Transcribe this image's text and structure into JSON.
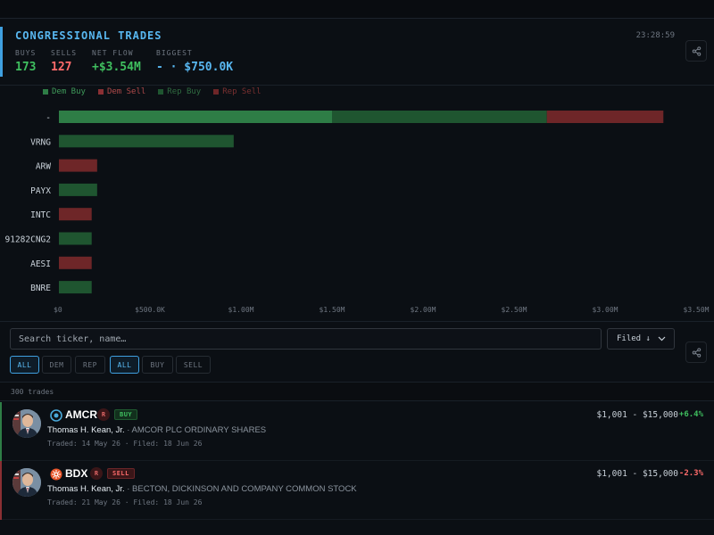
{
  "header": {
    "title": "CONGRESSIONAL TRADES",
    "time": "23:28:59",
    "stats": [
      {
        "label": "BUYS",
        "value": "173",
        "color": "#3fbf5f"
      },
      {
        "label": "SELLS",
        "value": "127",
        "color": "#ff6b6b"
      },
      {
        "label": "NET FLOW",
        "value": "+$3.54M",
        "color": "#3fbf5f"
      },
      {
        "label": "BIGGEST",
        "value": "- · $750.0K",
        "color": "#58b7f0"
      }
    ]
  },
  "legend": [
    {
      "label": "Dem Buy",
      "color": "#2e7d46",
      "text_color": "#3f9a5a"
    },
    {
      "label": "Dem Sell",
      "color": "#8a2f33",
      "text_color": "#b04a4a"
    },
    {
      "label": "Rep Buy",
      "color": "#1f5530",
      "text_color": "#2f6b40"
    },
    {
      "label": "Rep Sell",
      "color": "#6e2628",
      "text_color": "#7a3030"
    }
  ],
  "chart_data": {
    "type": "bar",
    "orientation": "horizontal",
    "stacked": true,
    "categories": [
      "-",
      "VRNG",
      "ARW",
      "PAYX",
      "INTC",
      "91282CNG2",
      "AESI",
      "BNRE"
    ],
    "series": [
      {
        "name": "Dem Buy",
        "color": "#2e7d46",
        "values": [
          1500000,
          0,
          0,
          0,
          0,
          0,
          0,
          0
        ]
      },
      {
        "name": "Dem Sell",
        "color": "#8a2f33",
        "values": [
          0,
          0,
          0,
          0,
          0,
          0,
          0,
          0
        ]
      },
      {
        "name": "Rep Buy",
        "color": "#1f5530",
        "values": [
          1180000,
          960000,
          0,
          210000,
          0,
          180000,
          0,
          180000
        ]
      },
      {
        "name": "Rep Sell",
        "color": "#6e2628",
        "values": [
          640000,
          0,
          210000,
          0,
          180000,
          0,
          180000,
          0
        ]
      }
    ],
    "x_ticks": [
      "$0",
      "$500.0K",
      "$1.00M",
      "$1.50M",
      "$2.00M",
      "$2.50M",
      "$3.00M",
      "$3.50M"
    ],
    "xlim": [
      0,
      3500000
    ],
    "legend_position": "top-left",
    "grid": false
  },
  "filters": {
    "search_placeholder": "Search ticker, name…",
    "sort_label": "Filed ↓",
    "party_pills": [
      "ALL",
      "DEM",
      "REP"
    ],
    "side_pills": [
      "ALL",
      "BUY",
      "SELL"
    ],
    "active_party": "ALL",
    "active_side": "ALL"
  },
  "count_text": "300 trades",
  "trades": [
    {
      "ticker": "AMCR",
      "party": "R",
      "side": "BUY",
      "member": "Thomas H. Kean, Jr.",
      "company": " · AMCOR PLC ORDINARY SHARES",
      "traded": "Traded: 14 May 26",
      "filed": "· Filed: 18 Jun 26",
      "amount": "$1,001 - $15,000",
      "change": "+6.4%",
      "change_color": "#3fbf5f",
      "logo_icon": "amcor-logo-icon"
    },
    {
      "ticker": "BDX",
      "party": "R",
      "side": "SELL",
      "member": "Thomas H. Kean, Jr.",
      "company": " · BECTON, DICKINSON AND COMPANY COMMON STOCK",
      "traded": "Traded: 21 May 26",
      "filed": "· Filed: 18 Jun 26",
      "amount": "$1,001 - $15,000",
      "change": "-2.3%",
      "change_color": "#ff6b6b",
      "logo_icon": "bd-logo-icon"
    }
  ]
}
